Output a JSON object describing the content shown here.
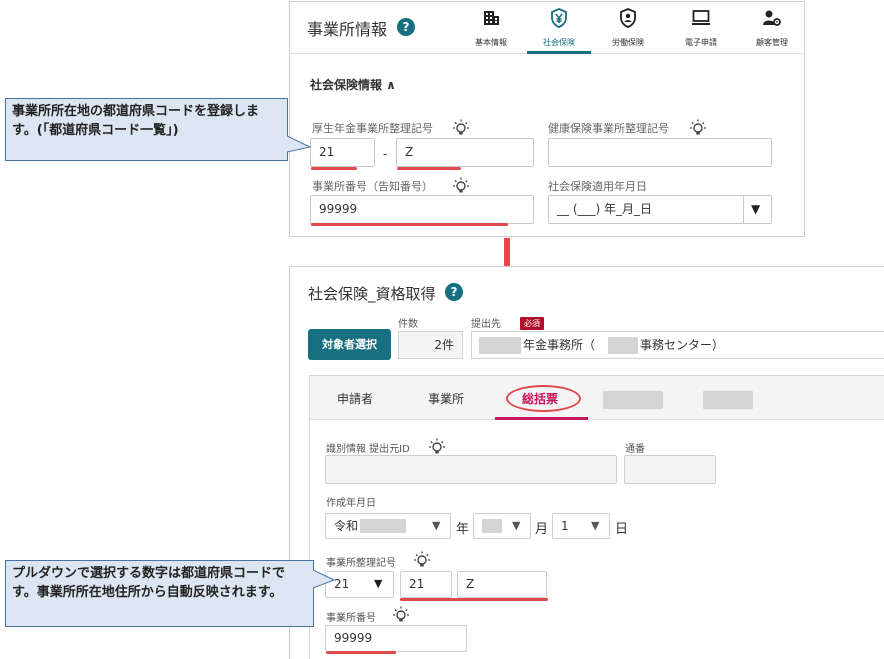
{
  "top_panel": {
    "title": "事業所情報",
    "help": "?",
    "nav": [
      {
        "label": "基本情報",
        "icon": "building-icon"
      },
      {
        "label": "社会保険",
        "icon": "yen-shield-icon"
      },
      {
        "label": "労働保険",
        "icon": "badge-shield-icon"
      },
      {
        "label": "電子申請",
        "icon": "monitor-icon"
      },
      {
        "label": "顧客管理",
        "icon": "user-gear-icon"
      }
    ],
    "active_nav": "社会保険",
    "section_title": "社会保険情報 ∧",
    "fields": {
      "pension_label": "厚生年金事業所整理記号",
      "pension_code_1": "21",
      "dash": "-",
      "pension_code_2": "Z",
      "health_label": "健康保険事業所整理記号",
      "health_value": "",
      "office_no_label": "事業所番号（告知番号）",
      "office_no_value": "99999",
      "apply_date_label": "社会保険適用年月日",
      "apply_date_value": "__ (___) 年_月_日",
      "apply_date_arrow": "▼"
    }
  },
  "bottom_panel": {
    "title": "社会保険_資格取得",
    "help": "?",
    "count_label": "件数",
    "dest_label": "提出先",
    "required_badge": "必須",
    "select_button": "対象者選択",
    "count_value": "2件",
    "dest_value_1": "年金事務所（",
    "dest_value_2": "事務センター）",
    "tabs": [
      "申請者",
      "事業所",
      "総括票"
    ],
    "active_tab": "総括票",
    "form": {
      "id_label": "識別情報 提出元ID",
      "serial_label": "通番",
      "created_label": "作成年月日",
      "era_value": "令和",
      "year_unit": "年",
      "month_unit": "月",
      "day_value": "1",
      "day_unit": "日",
      "arrow": "▼",
      "office_code_label": "事業所整理記号",
      "pref_select_value": "21",
      "office_code_1": "21",
      "office_code_2": "Z",
      "office_no_label": "事業所番号",
      "office_no_value": "99999"
    }
  },
  "callouts": {
    "top": "事業所所在地の都道府県コードを登録します。(「都道府県コード一覧」)",
    "bottom": "プルダウンで選択する数字は都道府県コードです。事業所所在地住所から自動反映されます。"
  },
  "colors": {
    "accent": "#17707f",
    "highlight_red": "#e0484c",
    "tab_active": "#c3185c",
    "required": "#b0102a",
    "callout_bg": "#dce6f2",
    "callout_border": "#4a74a8"
  }
}
